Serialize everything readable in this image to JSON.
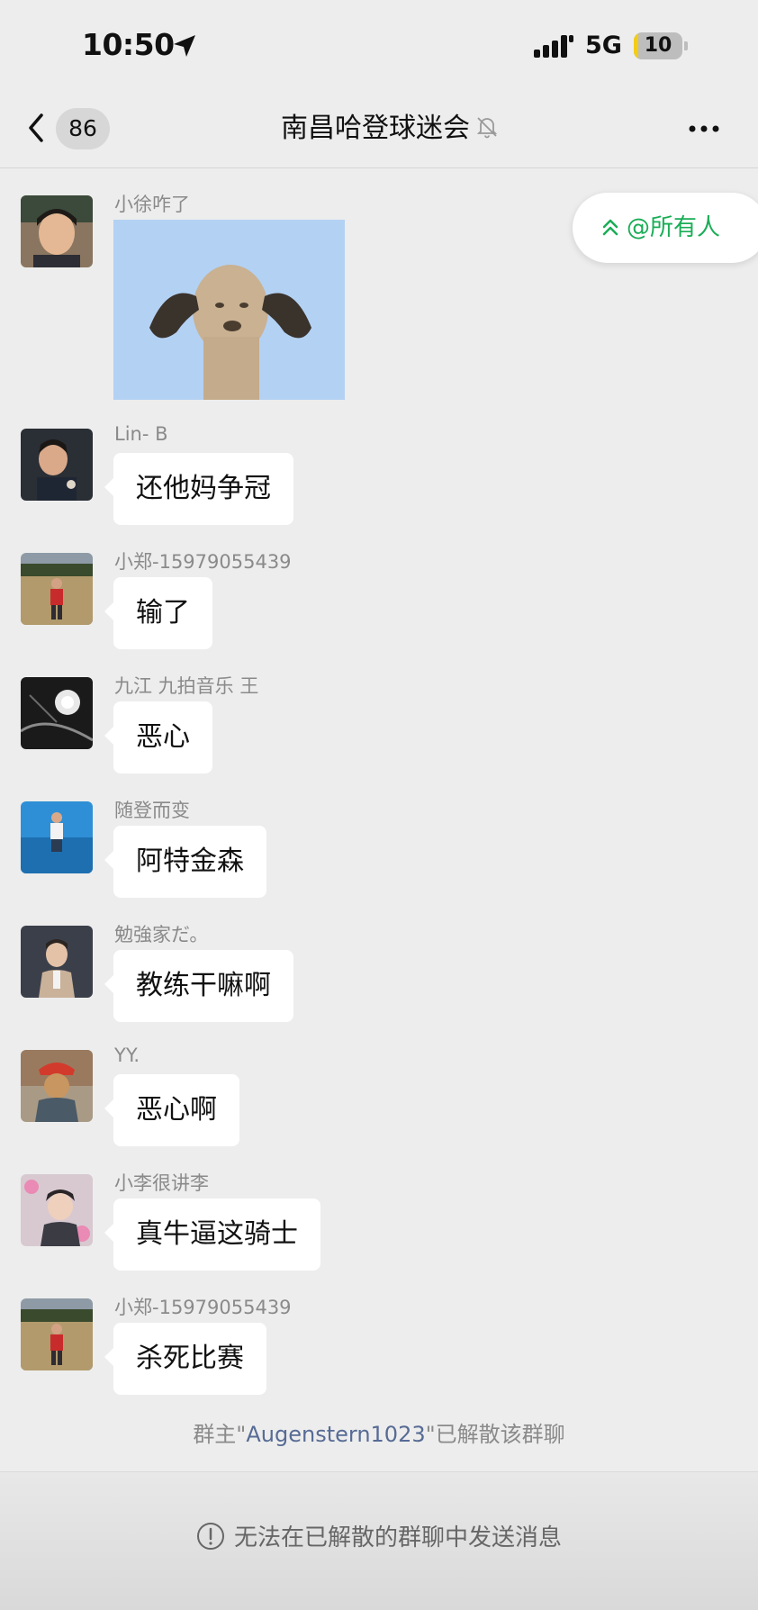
{
  "status_bar": {
    "time": "10:50",
    "network": "5G",
    "battery": "10",
    "battery_level_percent": 10
  },
  "nav": {
    "back_count": "86",
    "title": "南昌哈登球迷会",
    "muted": true
  },
  "mention_pill": {
    "label": "@所有人"
  },
  "messages": [
    {
      "sender": "小徐咋了",
      "type": "sticker",
      "text": ""
    },
    {
      "sender": "Lin- B",
      "type": "text",
      "text": "还他妈争冠"
    },
    {
      "sender": "小郑-15979055439",
      "type": "text",
      "text": "输了"
    },
    {
      "sender": "九江 九拍音乐  王",
      "type": "text",
      "text": "恶心"
    },
    {
      "sender": "随登而变",
      "type": "text",
      "text": "阿特金森"
    },
    {
      "sender": "勉強家だ。",
      "type": "text",
      "text": "教练干嘛啊"
    },
    {
      "sender": "YY.",
      "type": "text",
      "text": "恶心啊"
    },
    {
      "sender": "小李很讲李",
      "type": "text",
      "text": "真牛逼这骑士"
    },
    {
      "sender": "小郑-15979055439",
      "type": "text",
      "text": "杀死比赛"
    }
  ],
  "system_notice": {
    "prefix": "群主\"",
    "owner": "Augenstern1023",
    "suffix": "\"已解散该群聊"
  },
  "footer": {
    "text": "无法在已解散的群聊中发送消息"
  },
  "colors": {
    "background": "#ededed",
    "accent": "#1aad57",
    "link": "#576b95",
    "bubble": "#ffffff"
  }
}
